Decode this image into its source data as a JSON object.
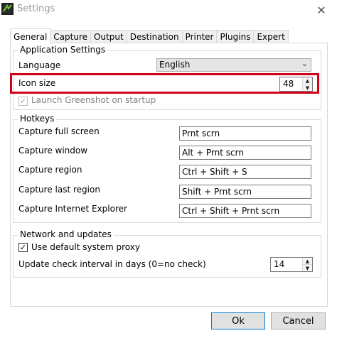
{
  "window": {
    "title": "Settings",
    "close_glyph": "✕",
    "app_icon": "greenshot-icon"
  },
  "tabs": [
    {
      "label": "General",
      "active": true
    },
    {
      "label": "Capture"
    },
    {
      "label": "Output"
    },
    {
      "label": "Destination"
    },
    {
      "label": "Printer"
    },
    {
      "label": "Plugins"
    },
    {
      "label": "Expert"
    }
  ],
  "application_settings": {
    "group_title": "Application Settings",
    "language_label": "Language",
    "language_value": "English",
    "icon_size_label": "Icon size",
    "icon_size_value": "48",
    "launch_label": "Launch Greenshot on startup",
    "launch_checked": true,
    "launch_disabled": true
  },
  "hotkeys": {
    "group_title": "Hotkeys",
    "items": [
      {
        "label": "Capture full screen",
        "value": "Prnt scrn"
      },
      {
        "label": "Capture window",
        "value": "Alt + Prnt scrn"
      },
      {
        "label": "Capture region",
        "value": "Ctrl + Shift + S"
      },
      {
        "label": "Capture last region",
        "value": "Shift + Prnt scrn"
      },
      {
        "label": "Capture Internet Explorer",
        "value": "Ctrl + Shift + Prnt scrn"
      }
    ]
  },
  "network": {
    "group_title": "Network and updates",
    "proxy_label": "Use default system proxy",
    "proxy_checked": true,
    "interval_label": "Update check interval in days (0=no check)",
    "interval_value": "14"
  },
  "buttons": {
    "ok": "Ok",
    "cancel": "Cancel"
  },
  "colors": {
    "highlight": "#d0021b",
    "default_button_border": "#0078d7"
  }
}
